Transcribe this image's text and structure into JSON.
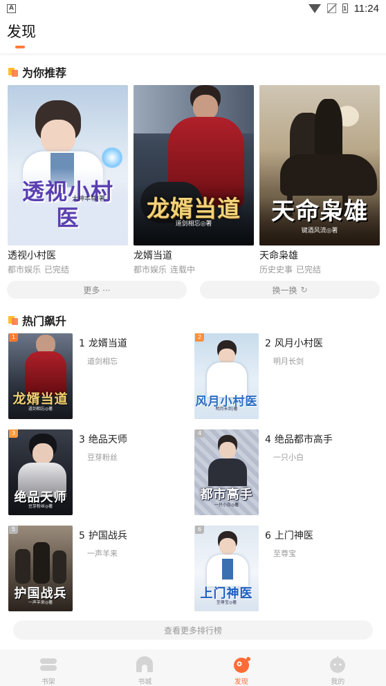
{
  "status_bar": {
    "time": "11:24",
    "notif_icon": "A",
    "battery_label": "1"
  },
  "header": {
    "title": "发现"
  },
  "recommend": {
    "section_title": "为你推荐",
    "books": [
      {
        "name": "透视小村医",
        "genre": "都市娱乐",
        "status": "已完结",
        "cover_title": "透视小村医",
        "cover_author": "大神本尊|著",
        "cover_en": "TOUSHI XIAOCUNYI"
      },
      {
        "name": "龙婿当道",
        "genre": "都市娱乐",
        "status": "连载中",
        "cover_title": "龙婿当道",
        "cover_author": "道剑相忘◎著"
      },
      {
        "name": "天命枭雄",
        "genre": "历史史事",
        "status": "已完结",
        "cover_title": "天命枭雄",
        "cover_author": "键酒风流◎著"
      }
    ],
    "more_label": "更多 ···",
    "refresh_label": "换一换"
  },
  "hot": {
    "section_title": "热门飙升",
    "books": [
      {
        "rank": "1",
        "title": "龙婿当道",
        "author": "道剑相忘",
        "cover_title": "龙婿当道",
        "cover_author": "道剑相忘◎著",
        "badge_color": "#ff7a2e"
      },
      {
        "rank": "2",
        "title": "风月小村医",
        "author": "明月长剑",
        "cover_title": "风月小村医",
        "cover_author": "明月长剑|著",
        "badge_color": "#ff8f3a"
      },
      {
        "rank": "3",
        "title": "绝品天师",
        "author": "豆芽粉丝",
        "cover_title": "绝品天师",
        "cover_author": "豆芽粉丝◎著",
        "badge_color": "#ff9a3d"
      },
      {
        "rank": "4",
        "title": "绝品都市高手",
        "author": "一只小白",
        "cover_title": "都市高手",
        "cover_author": "一只小白◎著",
        "badge_color": "#b8b8b8"
      },
      {
        "rank": "5",
        "title": "护国战兵",
        "author": "一声羊来",
        "cover_title": "护国战兵",
        "cover_author": "一声羊来◎著",
        "badge_color": "#b8b8b8"
      },
      {
        "rank": "6",
        "title": "上门神医",
        "author": "至尊宝",
        "cover_title": "上门神医",
        "cover_author": "至尊宝◎著",
        "badge_color": "#b8b8b8"
      }
    ],
    "more_label": "查看更多排行榜"
  },
  "bottom_nav": {
    "items": [
      {
        "label": "书架",
        "icon": "bookshelf-icon"
      },
      {
        "label": "书城",
        "icon": "bookstore-icon"
      },
      {
        "label": "发现",
        "icon": "discover-icon"
      },
      {
        "label": "我的",
        "icon": "profile-icon"
      }
    ],
    "active_color": "#ff6b35"
  }
}
